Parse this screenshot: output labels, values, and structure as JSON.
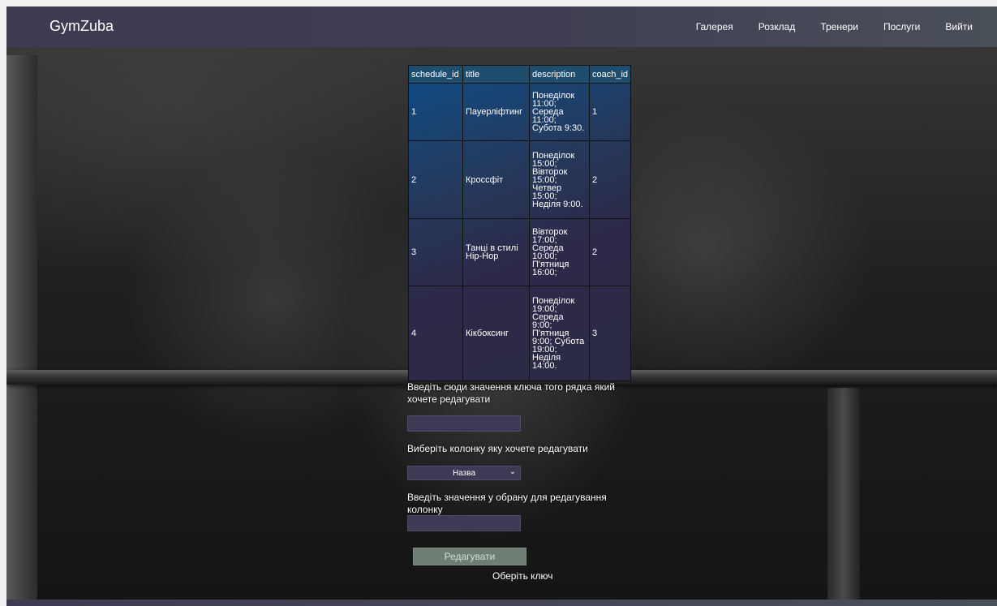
{
  "header": {
    "logo": "GymZuba",
    "nav": [
      "Галерея",
      "Розклад",
      "Тренери",
      "Послуги",
      "Вийти"
    ]
  },
  "table": {
    "headers": [
      "schedule_id",
      "title",
      "description",
      "coach_id"
    ],
    "rows": [
      {
        "id": "1",
        "title": "Пауерліфтинг",
        "description": [
          "Понеділок",
          "11:00;",
          "Середа",
          "11:00;",
          "Субота 9:30."
        ],
        "coach": "1"
      },
      {
        "id": "2",
        "title": "Кроссфіт",
        "description": [
          "Понеділок",
          "15:00;",
          "Вівторок",
          "15:00;",
          "Четвер",
          "15:00;",
          "Неділя 9:00."
        ],
        "coach": "2"
      },
      {
        "id": "3",
        "title": [
          "Танці в стилі",
          "Hip-Hop"
        ],
        "description": [
          "Вівторок",
          "17:00;",
          "Середа",
          "10:00;",
          "П'ятниця",
          "16:00;"
        ],
        "coach": "2"
      },
      {
        "id": "4",
        "title": "Кікбоксинг",
        "description": [
          "Понеділок",
          "19:00;",
          "Середа",
          "9:00;",
          "П'ятниця",
          "9:00; Субота",
          "19:00;",
          "Неділя",
          "14:00."
        ],
        "coach": "3"
      }
    ]
  },
  "form": {
    "key_label": "Введіть сюди значення ключа того рядка який хочете редагувати",
    "key_value": "",
    "column_label": "Виберіть колонку яку хочете редагувати",
    "column_selected": "Назва",
    "value_label": "Введіть значення у обрану для редагування колонку",
    "value_value": "",
    "submit_label": "Редагувати",
    "hint": "Оберіть ключ"
  },
  "colors": {
    "header_bg": "#3e3b52",
    "table_header": "#1f4d6e",
    "input_bg": "#3d3a55",
    "button_bg": "#6f7e74"
  }
}
